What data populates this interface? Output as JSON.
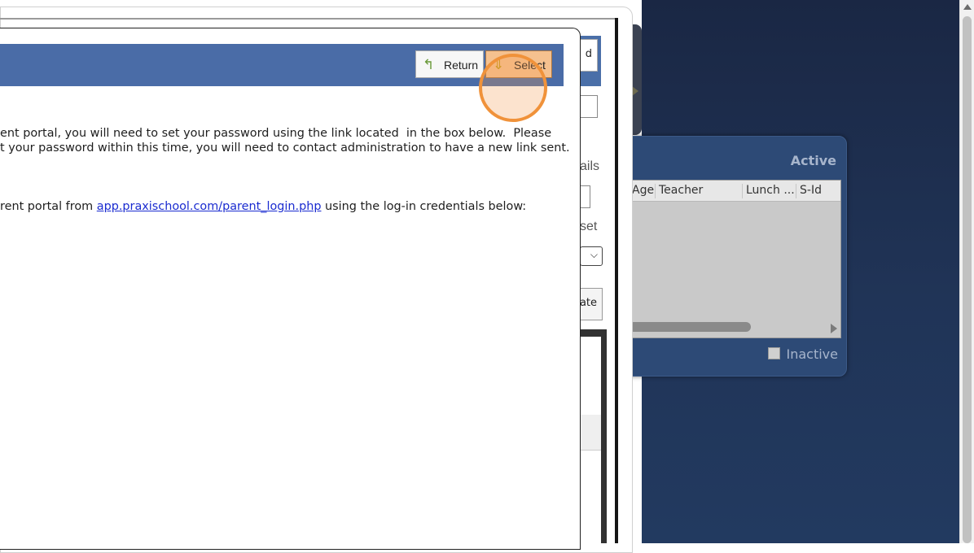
{
  "modal": {
    "return_label": "Return",
    "select_label": "Select",
    "body": {
      "line1": "ent portal, you will need to set your password using the link located  in the box below.  Please",
      "line2": "t your password within this time, you will need to contact administration to have a new link sent.",
      "line3_before": "rent portal from ",
      "line3_link": "app.praxischool.com/parent_login.php",
      "line3_after": " using the log-in credentials below:"
    }
  },
  "behind_form": {
    "button_fragment": "d",
    "label_fragment_1": "ails",
    "label_fragment_2": "set",
    "button2_fragment": "ate",
    "select_arrow": "⌵"
  },
  "student_panel": {
    "status_label": "Active",
    "columns": [
      "Age",
      "Teacher",
      "Lunch ...",
      "S-Id"
    ],
    "inactive_label": "Inactive"
  },
  "colors": {
    "header_blue": "#4a6ca7",
    "highlight": "#f0923a",
    "link": "#1a2bd0"
  }
}
